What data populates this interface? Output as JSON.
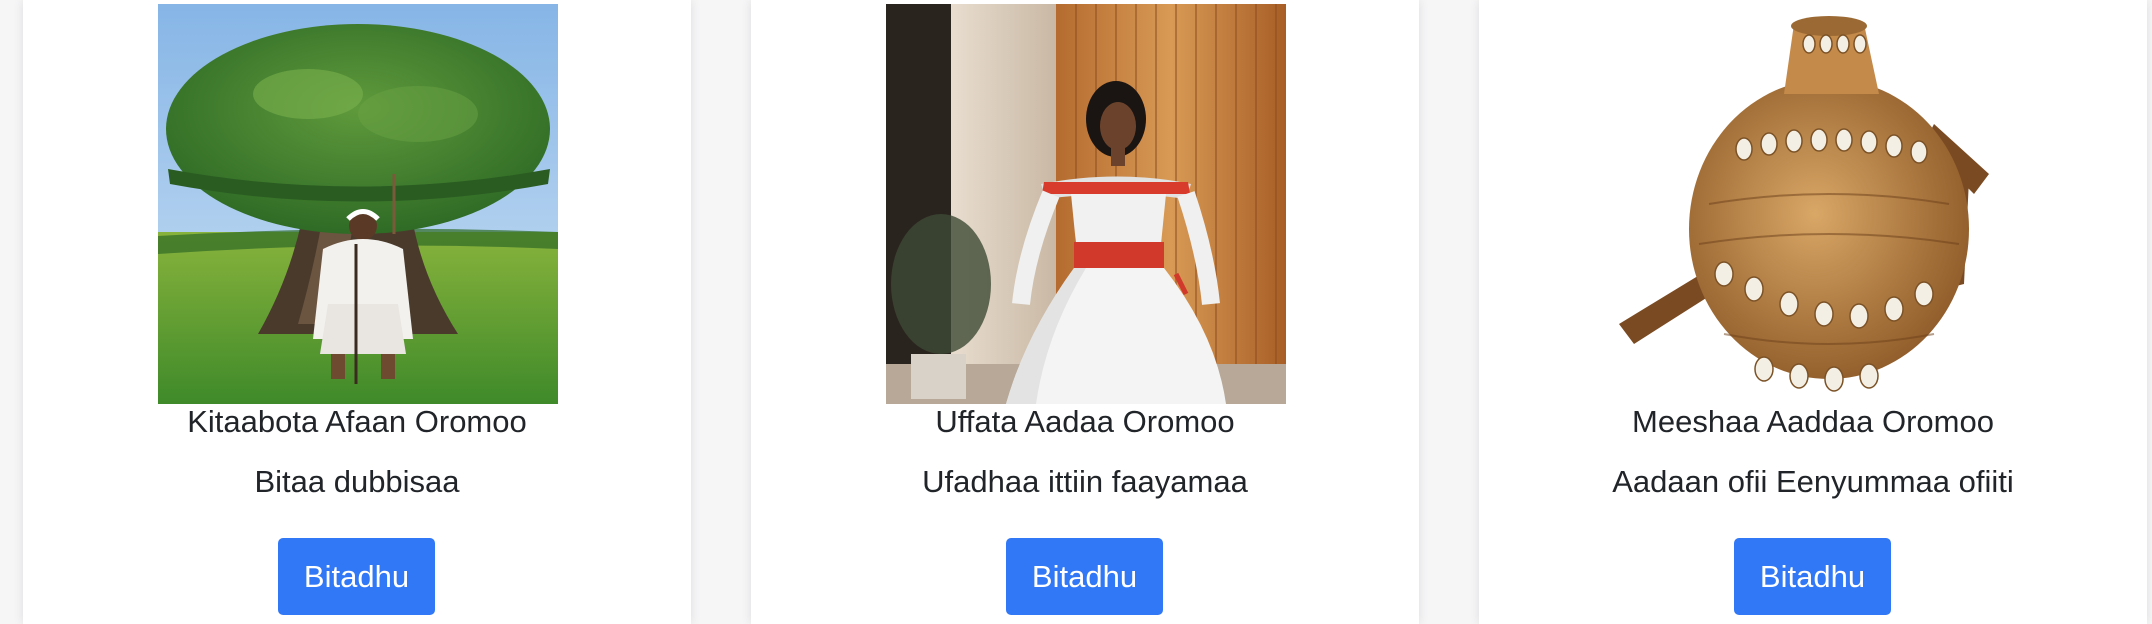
{
  "cards": [
    {
      "title": "Kitaabota Afaan Oromoo",
      "text": "Bitaa dubbisaa",
      "button_label": "Bitadhu",
      "image": "painting-of-elder-under-odaa-tree"
    },
    {
      "title": "Uffata Aadaa Oromoo",
      "text": "Ufadhaa ittiin faayamaa",
      "button_label": "Bitadhu",
      "image": "woman-in-white-traditional-dress"
    },
    {
      "title": "Meeshaa Aaddaa Oromoo",
      "text": "Aadaan ofii Eenyummaa ofiiti",
      "button_label": "Bitadhu",
      "image": "woven-gourd-container-with-cowrie-shells"
    }
  ],
  "colors": {
    "button": "#3178f6",
    "page_background": "#f6f6f7",
    "card_background": "#ffffff"
  }
}
